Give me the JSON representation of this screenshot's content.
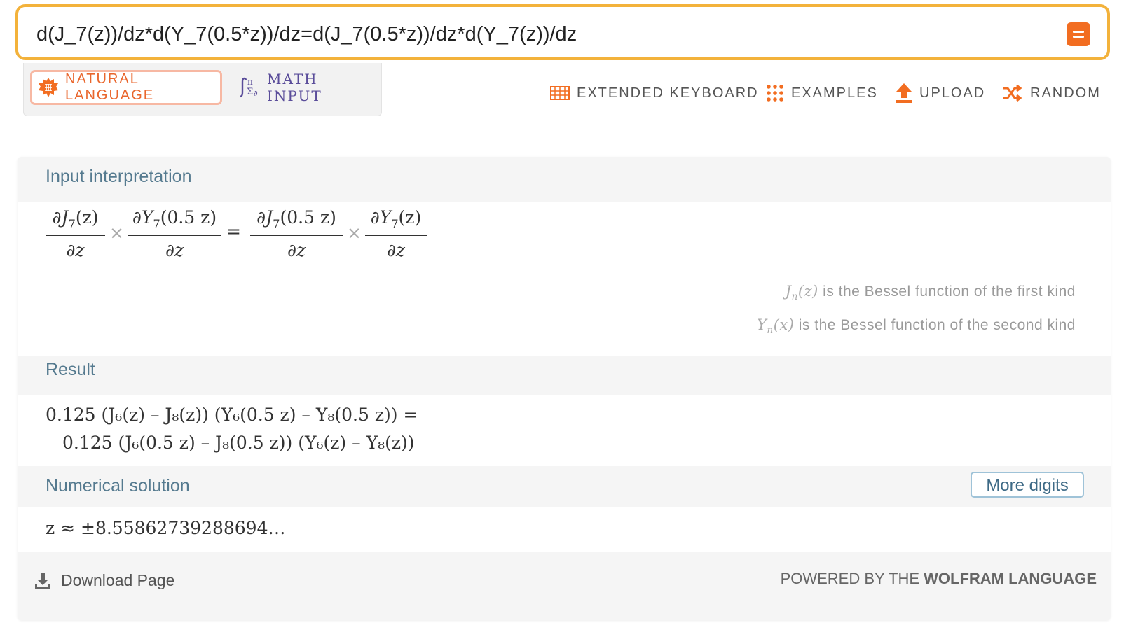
{
  "query": {
    "value": "d(J_7(z))/dz*d(Y_7(0.5*z))/dz=d(J_7(0.5*z))/dz*d(Y_7(z))/dz"
  },
  "input_modes": {
    "natural_language": "NATURAL LANGUAGE",
    "math_input": "MATH INPUT"
  },
  "toolbar": {
    "extended_keyboard": "EXTENDED KEYBOARD",
    "examples": "EXAMPLES",
    "upload": "UPLOAD",
    "random": "RANDOM"
  },
  "pods": {
    "input_interpretation": {
      "title": "Input interpretation",
      "partial": "∂",
      "z": "z",
      "times": "×",
      "equals": "=",
      "arg_z": "(z)",
      "arg_half_z": "(0.5 z)",
      "J": "J",
      "Y": "Y",
      "n7": "7",
      "notes": [
        {
          "fn": "J",
          "sub": "n",
          "arg": "(z)",
          "text": " is the Bessel function of the first kind"
        },
        {
          "fn": "Y",
          "sub": "n",
          "arg": "(x)",
          "text": " is the Bessel function of the second kind"
        }
      ]
    },
    "result": {
      "title": "Result",
      "line1": "0.125 (J₆(z) – J₈(z)) (Y₆(0.5 z) – Y₈(0.5 z)) =",
      "line2": "0.125 (J₆(0.5 z) – J₈(0.5 z)) (Y₆(z) – Y₈(z))"
    },
    "numerical_solution": {
      "title": "Numerical solution",
      "more_digits": "More digits",
      "value": "z ≈ ±8.55862739288694…"
    }
  },
  "footer": {
    "download": "Download Page",
    "powered_prefix": "POWERED BY THE ",
    "powered_brand": "WOLFRAM LANGUAGE"
  },
  "colors": {
    "query_border": "#f3b23b",
    "accent_orange": "#f26d21",
    "pod_title": "#557a8f",
    "math_input_purple": "#5a4d9a"
  },
  "icons": {
    "equals": "equals-icon",
    "natural_language": "sun-gear-icon",
    "math_input": "integral-sigma-icon",
    "extended_keyboard": "keyboard-grid-icon",
    "examples": "dots-grid-icon",
    "upload": "upload-arrow-icon",
    "random": "shuffle-icon",
    "download": "download-icon"
  }
}
